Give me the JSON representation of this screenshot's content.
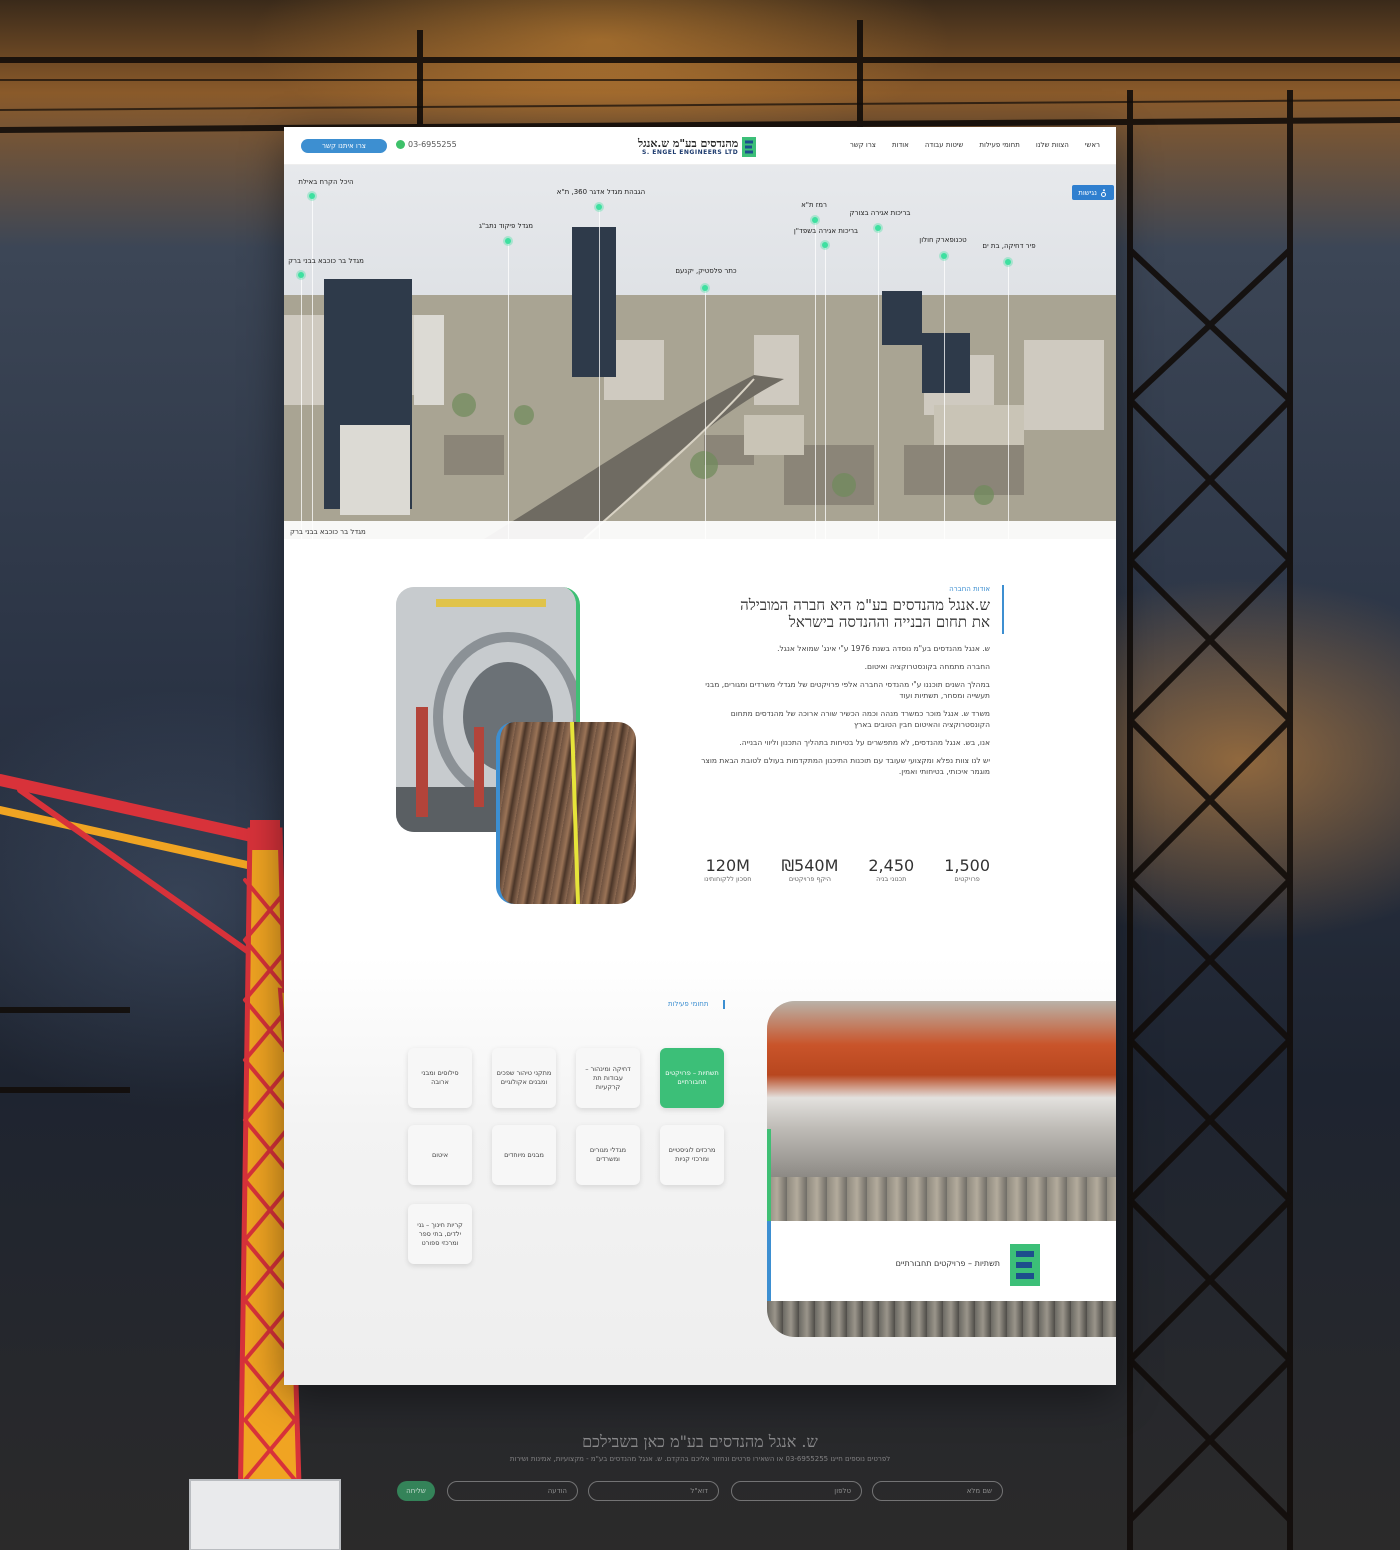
{
  "nav": {
    "contact_button": "צרו איתנו קשר",
    "phone": "03-6955255",
    "logo_hebrew_strong": "ש.אנגל",
    "logo_hebrew_rest": "מהנדסים בע\"מ",
    "logo_english": "S. ENGEL ENGINEERS LTD",
    "menu": [
      "ראשי",
      "הצוות שלנו",
      "תחומי פעילות",
      "שיטות עבודה",
      "אודות",
      "צרו קשר"
    ]
  },
  "hero": {
    "accessibility_label": "נגישות",
    "strip_label": "מגדל בר כוכבא בבני ברק",
    "pins": [
      {
        "label": "היכל הקרח באילת"
      },
      {
        "label": "מגדל בר כוכבא בבני ברק"
      },
      {
        "label": "מגדל פיקוד נתב\"ג"
      },
      {
        "label": "הגבהת מגדל אדגר 360, ת\"א"
      },
      {
        "label": "כתר פלסטיק, יקנעם"
      },
      {
        "label": "רמז ת\"א"
      },
      {
        "label": "בריכות אגירה בשפד\"ן"
      },
      {
        "label": "בריכות אגירה בצורק"
      },
      {
        "label": "טכנופארק חולון"
      },
      {
        "label": "פיר דחיקה, בת ים"
      }
    ]
  },
  "about": {
    "tag": "אודות החברה",
    "title_line1": "ש.אנגל מהנדסים בע\"מ היא חברה המובילה",
    "title_line2": "את תחום הבנייה וההנדסה בישראל",
    "paragraphs": [
      "ש. אנגל מהנדסים בע\"מ נוסדה בשנת 1976 ע\"י אינג' שמואל אנגל.",
      "החברה מתמחה בקונסטרוקציה ואיטום.",
      "במהלך השנים תוכננו ע\"י מהנדסי החברה אלפי פרויקטים של מגדלי משרדים ומגורים, מבני תעשייה ומסחר, תשתיות ועוד",
      "משרד ש. אנגל מוכר כמשרד מנהה וכמה הכשיר שורה ארוכה של מהנדסים מתחום הקונסטרוקציה והאיטום חבין הטובים בארץ",
      "אנו, בש. אנגל מהנדסים, לא מתפשרים על בטיחות בתהליך התכנון וליווי הבנייה.",
      "יש לנו צוות נפלא ומקצועי שעובד עם תוכנות התיכנון המתקדמות בעולם לטובת הבאת מוצר מוגמר איכותי, בטיחותי ואמין."
    ],
    "stats": [
      {
        "num": "1,500",
        "label": "פרויקטים"
      },
      {
        "num": "2,450",
        "label": "תכנוני בניה"
      },
      {
        "num": "₪540M",
        "label": "היקף פרויקטים"
      },
      {
        "num": "120M",
        "label": "חסכון ללקוחותינו"
      }
    ]
  },
  "activity": {
    "tag": "תחומי פעילות",
    "tiles": [
      "תשתיות – פרויקטים תחבורתיים",
      "דחיקה ומינהור – עבודות תת קרקעיות",
      "מתקני טיהור שפכים ומבנים אקולוגיים",
      "סילוסים ומבני ארובה",
      "מרכזים לוגיסטיים ומרכזי קניות",
      "מגדלי מגורים ומשרדים",
      "מבנים מיוחדים",
      "איטום",
      "קריות חינוך – גני ילדים, בתי ספר ומרכזי ספורט"
    ],
    "showcase_title": "תשתיות – פרויקטים תחבורתיים"
  },
  "cta": {
    "title_strong": "ש.",
    "title_rest": "אנגל מהנדסים בע\"מ כאן בשבילכם",
    "subtitle": "לפרטים נוספים חייגו 03-6955255 או השאירו פרטים ונחזור אליכם בהקדם. ש. אנגל מהנדסים בע\"מ - מקצועיות, אמינות ושירות",
    "fields": [
      "שם מלא",
      "טלפון",
      "דוא\"ל",
      "הודעה"
    ],
    "send": "שליחה"
  },
  "colors": {
    "accent_blue": "#3d8fd1",
    "accent_green": "#3cbf78"
  }
}
